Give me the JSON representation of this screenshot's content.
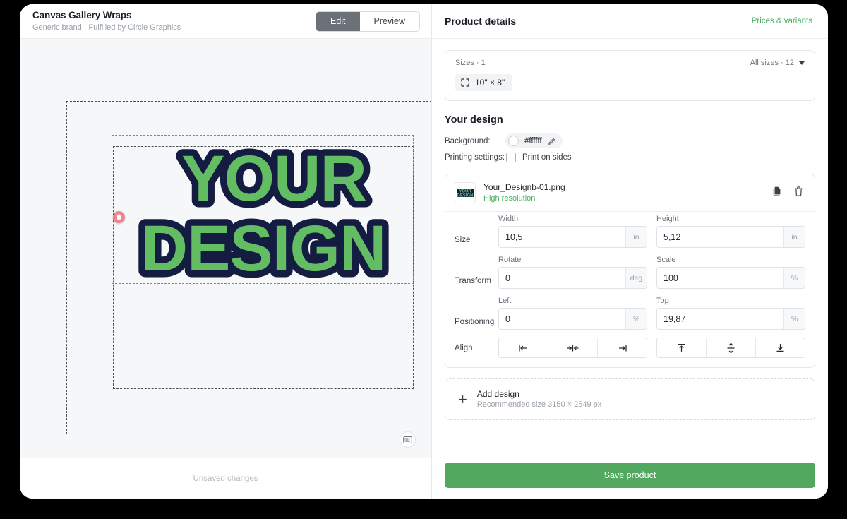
{
  "editor": {
    "product_title": "Canvas Gallery Wraps",
    "product_subtitle": "Generic brand · Fulfilled by Circle Graphics",
    "mode_tabs": [
      {
        "label": "Edit",
        "active": true
      },
      {
        "label": "Preview",
        "active": false
      }
    ],
    "canvas": {
      "design_text_line1": "YOUR",
      "design_text_line2": "DESIGN",
      "design_fill_color": "#62bd63",
      "design_shadow_color": "#151c42",
      "selection_color": "#35b35f",
      "guide_color": "#4a4f57",
      "handles": [
        {
          "name": "delete-handle",
          "color": "#f0848c"
        },
        {
          "name": "resize-handle",
          "color": "#45b565"
        },
        {
          "name": "rotate-handle",
          "color": "#45b565"
        }
      ],
      "keyboard_shortcuts_icon": "keyboard-icon"
    },
    "footer_status": "Unsaved changes"
  },
  "details": {
    "title": "Product details",
    "prices_variants_link": "Prices & variants",
    "accent_color": "#4bae63",
    "sizes": {
      "count_label": "Sizes · 1",
      "all_sizes_label": "All sizes · 12",
      "selected_size": "10\" × 8\"",
      "size_icon": "expand-corners-icon"
    },
    "your_design": {
      "heading": "Your design",
      "background_label": "Background:",
      "background_value": "#ffffff",
      "background_edit_icon": "pencil-icon",
      "printing_label": "Printing settings:",
      "print_on_sides_label": "Print on sides",
      "print_on_sides_checked": false
    },
    "design_file": {
      "name": "Your_Designb-01.png",
      "resolution_status": "High resolution",
      "duplicate_icon": "copy-icon",
      "delete_icon": "trash-icon",
      "thumbnail_line1": "YOUR",
      "thumbnail_line2": "DESIGN"
    },
    "properties": [
      {
        "label": "Size",
        "fields": [
          {
            "caption": "Width",
            "value": "10,5",
            "unit": "in",
            "name": "width-input"
          },
          {
            "caption": "Height",
            "value": "5,12",
            "unit": "in",
            "name": "height-input"
          }
        ]
      },
      {
        "label": "Transform",
        "fields": [
          {
            "caption": "Rotate",
            "value": "0",
            "unit": "deg",
            "name": "rotate-input"
          },
          {
            "caption": "Scale",
            "value": "100",
            "unit": "%",
            "name": "scale-input"
          }
        ]
      },
      {
        "label": "Positioning",
        "fields": [
          {
            "caption": "Left",
            "value": "0",
            "unit": "%",
            "name": "left-input"
          },
          {
            "caption": "Top",
            "value": "19,87",
            "unit": "%",
            "name": "top-input"
          }
        ]
      }
    ],
    "align": {
      "label": "Align",
      "horizontal": [
        {
          "name": "align-left-button",
          "icon": "align-left-icon"
        },
        {
          "name": "align-center-horizontal-button",
          "icon": "align-center-horizontal-icon"
        },
        {
          "name": "align-right-button",
          "icon": "align-right-icon"
        }
      ],
      "vertical": [
        {
          "name": "align-top-button",
          "icon": "align-top-icon"
        },
        {
          "name": "align-middle-button",
          "icon": "align-middle-icon"
        },
        {
          "name": "align-bottom-button",
          "icon": "align-bottom-icon"
        }
      ]
    },
    "add_design": {
      "plus": "+",
      "title": "Add design",
      "subtitle": "Recommended size 3150 × 2549 px"
    },
    "save_button": "Save product",
    "save_button_color": "#53a85f"
  }
}
